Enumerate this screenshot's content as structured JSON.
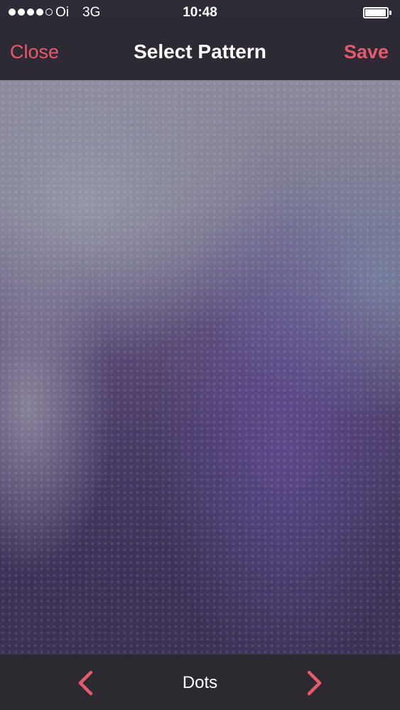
{
  "status_bar": {
    "signal_bars_filled": 4,
    "signal_bars_total": 5,
    "carrier": "Oi",
    "network": "3G",
    "time": "10:48",
    "battery_level": 0.95
  },
  "nav": {
    "close_label": "Close",
    "title": "Select Pattern",
    "save_label": "Save"
  },
  "pattern": {
    "name": "Dots"
  },
  "icons": {
    "previous": "chevron-left-icon",
    "next": "chevron-right-icon"
  },
  "colors": {
    "accent": "#e65a6e",
    "bar_background": "#2c2931"
  }
}
